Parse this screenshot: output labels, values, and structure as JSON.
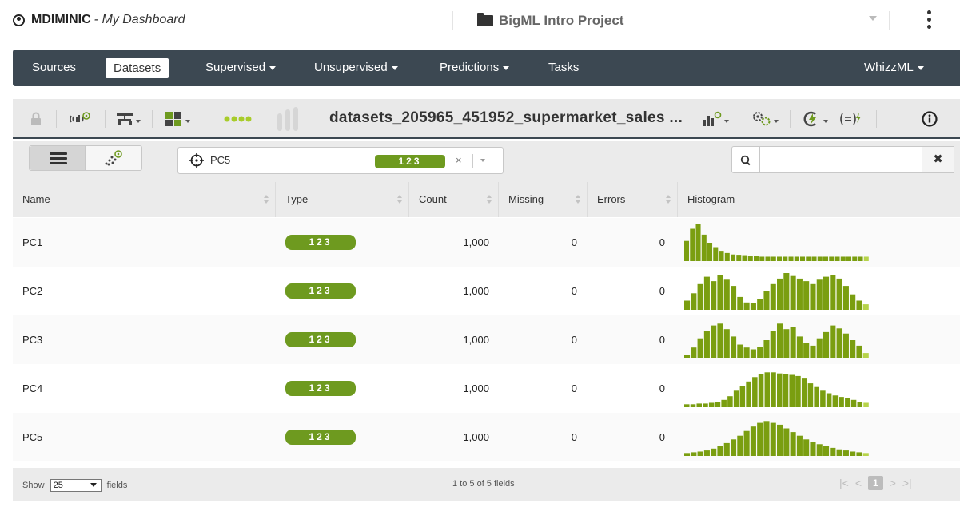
{
  "header": {
    "user": "MDIMINIC",
    "dashboard": "My Dashboard",
    "project": "BigML Intro Project"
  },
  "nav": {
    "sources": "Sources",
    "datasets": "Datasets",
    "supervised": "Supervised",
    "unsupervised": "Unsupervised",
    "predictions": "Predictions",
    "tasks": "Tasks",
    "whizzml": "WhizzML"
  },
  "toolbar": {
    "dataset_title": "datasets_205965_451952_supermarket_sales ..."
  },
  "filter": {
    "selected_field": "PC5",
    "selected_type": "123",
    "clear": "×",
    "search_placeholder": "",
    "clear_search": "✖"
  },
  "table": {
    "columns": [
      "Name",
      "Type",
      "Count",
      "Missing",
      "Errors",
      "Histogram"
    ],
    "rows": [
      {
        "name": "PC1",
        "type": "123",
        "count": "1,000",
        "missing": "0",
        "errors": "0",
        "hist": [
          0.55,
          0.88,
          1.0,
          0.72,
          0.5,
          0.38,
          0.28,
          0.22,
          0.18,
          0.15,
          0.14,
          0.13,
          0.13,
          0.12,
          0.12,
          0.12,
          0.12,
          0.12,
          0.12,
          0.12,
          0.12,
          0.12,
          0.12,
          0.12,
          0.12,
          0.12,
          0.12,
          0.12,
          0.12,
          0.12,
          0.12,
          0.12
        ]
      },
      {
        "name": "PC2",
        "type": "123",
        "count": "1,000",
        "missing": "0",
        "errors": "0",
        "hist": [
          0.25,
          0.45,
          0.7,
          0.9,
          0.78,
          0.95,
          0.82,
          0.65,
          0.35,
          0.2,
          0.18,
          0.3,
          0.52,
          0.7,
          0.85,
          1.0,
          0.92,
          0.85,
          0.78,
          0.7,
          0.82,
          0.9,
          0.95,
          0.85,
          0.65,
          0.42,
          0.25,
          0.15
        ]
      },
      {
        "name": "PC3",
        "type": "123",
        "count": "1,000",
        "missing": "0",
        "errors": "0",
        "hist": [
          0.1,
          0.3,
          0.55,
          0.75,
          0.9,
          0.95,
          0.8,
          0.6,
          0.38,
          0.3,
          0.25,
          0.32,
          0.5,
          0.75,
          0.95,
          0.8,
          0.85,
          0.6,
          0.42,
          0.35,
          0.55,
          0.72,
          0.9,
          0.82,
          0.68,
          0.5,
          0.35,
          0.15
        ]
      },
      {
        "name": "PC4",
        "type": "123",
        "count": "1,000",
        "missing": "0",
        "errors": "0",
        "hist": [
          0.08,
          0.08,
          0.1,
          0.1,
          0.12,
          0.14,
          0.2,
          0.3,
          0.45,
          0.58,
          0.7,
          0.82,
          0.9,
          0.95,
          0.95,
          0.92,
          0.9,
          0.88,
          0.85,
          0.78,
          0.65,
          0.55,
          0.45,
          0.38,
          0.32,
          0.28,
          0.25,
          0.2,
          0.15,
          0.12
        ]
      },
      {
        "name": "PC5",
        "type": "123",
        "count": "1,000",
        "missing": "0",
        "errors": "0",
        "hist": [
          0.08,
          0.1,
          0.12,
          0.15,
          0.2,
          0.28,
          0.35,
          0.45,
          0.55,
          0.68,
          0.8,
          0.9,
          0.95,
          0.9,
          0.85,
          0.75,
          0.65,
          0.55,
          0.45,
          0.38,
          0.32,
          0.27,
          0.22,
          0.18,
          0.15,
          0.12,
          0.1,
          0.08
        ]
      }
    ]
  },
  "footer": {
    "show": "Show",
    "per_page": "25",
    "fields": "fields",
    "range": "1 to 5 of 5 fields",
    "current_page": "1"
  },
  "colors": {
    "navbar": "#3c4852",
    "badge": "#6e9a1f",
    "hist_bar": "#7a9e10",
    "hist_bar_light": "#b6d34a"
  }
}
